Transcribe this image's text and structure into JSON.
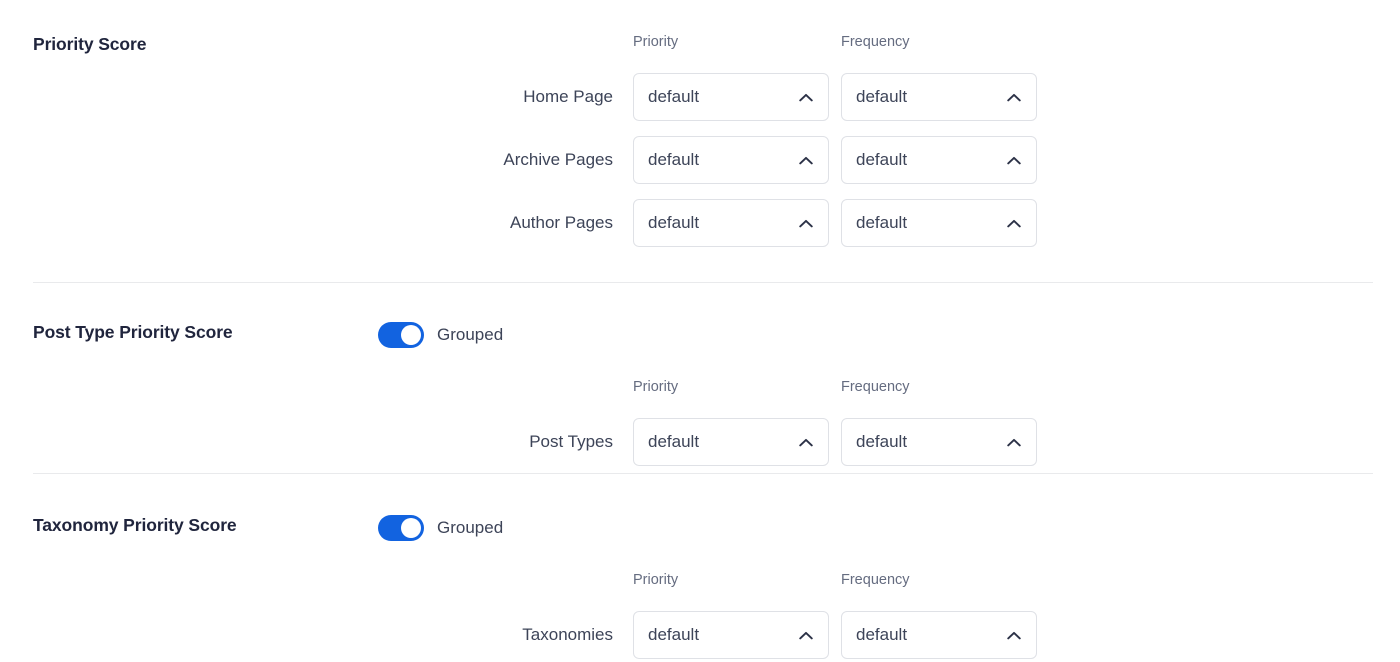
{
  "columns": {
    "priority_label": "Priority",
    "frequency_label": "Frequency"
  },
  "toggle": {
    "grouped_label": "Grouped",
    "on": true,
    "accent_color": "#1263e0"
  },
  "sections": [
    {
      "title": "Priority Score",
      "has_toggle": false,
      "rows": [
        {
          "label": "Home Page",
          "priority_value": "default",
          "frequency_value": "default"
        },
        {
          "label": "Archive Pages",
          "priority_value": "default",
          "frequency_value": "default"
        },
        {
          "label": "Author Pages",
          "priority_value": "default",
          "frequency_value": "default"
        }
      ]
    },
    {
      "title": "Post Type Priority Score",
      "has_toggle": true,
      "toggle_label": "Grouped",
      "rows": [
        {
          "label": "Post Types",
          "priority_value": "default",
          "frequency_value": "default"
        }
      ]
    },
    {
      "title": "Taxonomy Priority Score",
      "has_toggle": true,
      "toggle_label": "Grouped",
      "rows": [
        {
          "label": "Taxonomies",
          "priority_value": "default",
          "frequency_value": "default"
        }
      ]
    }
  ],
  "icons": {
    "chevron_up": "chevron-up-icon"
  },
  "colors": {
    "heading": "#20253d",
    "text": "#3d4458",
    "muted": "#656c80",
    "border": "#dfe1e6",
    "divider": "#e9eaec",
    "accent": "#1263e0"
  }
}
